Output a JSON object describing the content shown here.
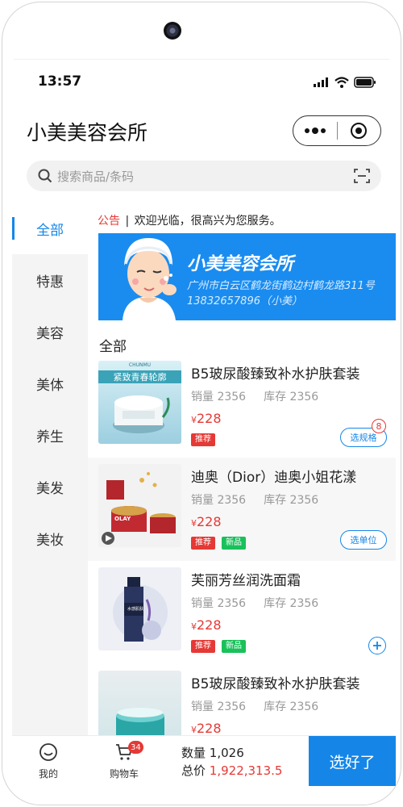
{
  "status": {
    "time": "13:57"
  },
  "header": {
    "title": "小美美容会所"
  },
  "search": {
    "placeholder": "搜索商品/条码"
  },
  "sidebar": {
    "items": [
      {
        "label": "全部",
        "active": true
      },
      {
        "label": "特惠"
      },
      {
        "label": "美容"
      },
      {
        "label": "美体"
      },
      {
        "label": "养生"
      },
      {
        "label": "美发"
      },
      {
        "label": "美妆"
      }
    ]
  },
  "notice": {
    "tag": "公告",
    "sep": "|",
    "text": "欢迎光临，很高兴为您服务。"
  },
  "banner": {
    "title": "小美美容会所",
    "address": "广州市白云区鹤龙街鹤边村鹤龙路311号",
    "phone": "13832657896（小美）"
  },
  "section": {
    "title": "全部"
  },
  "products": [
    {
      "name": "B5玻尿酸臻致补水护肤套装",
      "sales_label": "销量 2356",
      "stock_label": "库存 2356",
      "currency": "¥",
      "price": "228",
      "tags": [
        "推荐"
      ],
      "action": "选规格",
      "badge": "8"
    },
    {
      "name": "迪奥（Dior）迪奥小姐花漾",
      "sales_label": "销量 2356",
      "stock_label": "库存 2356",
      "currency": "¥",
      "price": "228",
      "tags": [
        "推荐",
        "新品"
      ],
      "action": "选单位"
    },
    {
      "name": "芙丽芳丝润洗面霜",
      "sales_label": "销量 2356",
      "stock_label": "库存 2356",
      "currency": "¥",
      "price": "228",
      "tags": [
        "推荐",
        "新品"
      ]
    },
    {
      "name": "B5玻尿酸臻致补水护肤套装",
      "sales_label": "销量 2356",
      "stock_label": "库存 2356",
      "currency": "¥",
      "price": "228"
    }
  ],
  "product_image_text": {
    "p1_brand": "CHUNMU",
    "p1_slogan": "紧致青春轮廓",
    "p2_brand": "OLAY",
    "p3_brand": "水感肌肤"
  },
  "bottom_bar": {
    "me_label": "我的",
    "cart_label": "购物车",
    "cart_badge": "34",
    "quantity_label": "数量",
    "quantity_value": "1,026",
    "total_label": "总价",
    "total_value": "1,922,313.5",
    "confirm_label": "选好了"
  },
  "colors": {
    "accent": "#1586e8",
    "price": "#e53935",
    "tag_recommend": "#e53935",
    "tag_new": "#19c15a",
    "banner": "#1a8cf0"
  },
  "icons": [
    "more-dots-icon",
    "target-icon",
    "search-icon",
    "scan-icon",
    "smile-icon",
    "cart-icon",
    "plus-icon",
    "signal-icon",
    "wifi-icon",
    "battery-icon"
  ]
}
